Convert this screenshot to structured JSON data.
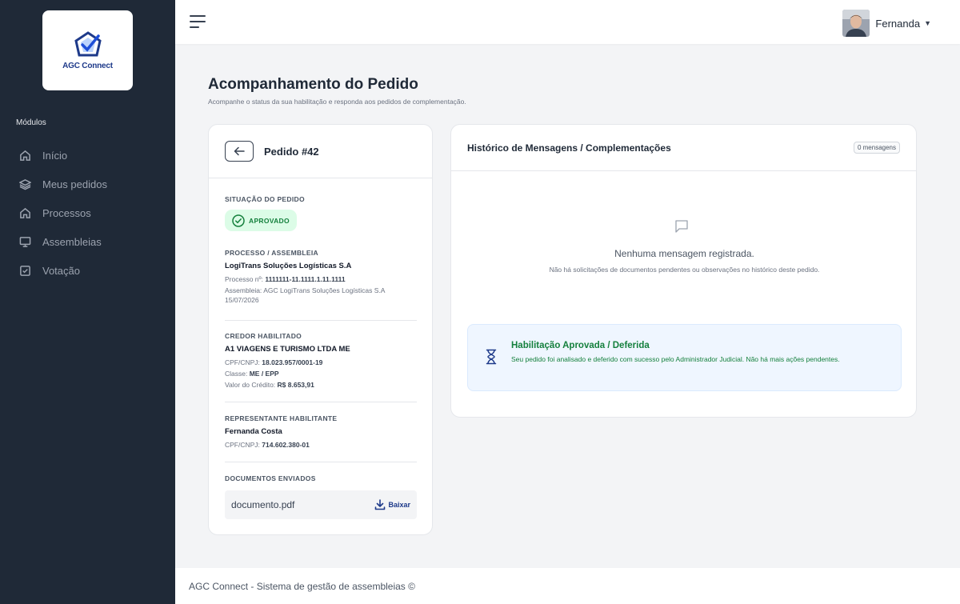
{
  "brand": {
    "name": "AGC Connect"
  },
  "sidebar": {
    "section_title": "Módulos",
    "items": [
      {
        "label": "Início",
        "icon": "home-icon"
      },
      {
        "label": "Meus pedidos",
        "icon": "layers-icon"
      },
      {
        "label": "Processos",
        "icon": "home-icon"
      },
      {
        "label": "Assembleias",
        "icon": "monitor-icon"
      },
      {
        "label": "Votação",
        "icon": "check-square-icon"
      }
    ]
  },
  "topbar": {
    "user_name": "Fernanda"
  },
  "page": {
    "title": "Acompanhamento do Pedido",
    "subtitle": "Acompanhe o status da sua habilitação e responda aos pedidos de complementação."
  },
  "order": {
    "title": "Pedido #42",
    "status_label": "SITUAÇÃO DO PEDIDO",
    "status": "APROVADO",
    "process": {
      "label": "PROCESSO / ASSEMBLEIA",
      "name": "LogiTrans Soluções Logísticas S.A",
      "number_prefix": "Processo nº:",
      "number": "1111111-11.1111.1.11.1111",
      "assembly": "Assembleia: AGC LogiTrans Soluções Logísticas S.A",
      "date": "15/07/2026"
    },
    "creditor": {
      "label": "CREDOR HABILITADO",
      "name": "A1 VIAGENS E TURISMO LTDA ME",
      "doc_prefix": "CPF/CNPJ:",
      "doc": "18.023.957/0001-19",
      "class_prefix": "Classe:",
      "class": "ME / EPP",
      "credit_prefix": "Valor do Crédito:",
      "credit": "R$ 8.653,91"
    },
    "representative": {
      "label": "REPRESENTANTE HABILITANTE",
      "name": "Fernanda Costa",
      "doc_prefix": "CPF/CNPJ:",
      "doc": "714.602.380-01"
    },
    "documents": {
      "label": "DOCUMENTOS ENVIADOS",
      "file_name": "documento.pdf",
      "download_label": "Baixar"
    }
  },
  "history": {
    "title": "Histórico de Mensagens / Complementações",
    "count": "0 mensagens",
    "empty_title": "Nenhuma mensagem registrada.",
    "empty_sub": "Não há solicitações de documentos pendentes ou observações no histórico deste pedido.",
    "approved_title": "Habilitação Aprovada / Deferida",
    "approved_text": "Seu pedido foi analisado e deferido com sucesso pelo Administrador Judicial. Não há mais ações pendentes."
  },
  "footer": {
    "text": "AGC Connect - Sistema de gestão de assembleias ©"
  },
  "colors": {
    "sidebar": "#1f2937",
    "accent": "#1e3a8a",
    "success": "#15803d",
    "info_bg": "#eff6ff"
  }
}
